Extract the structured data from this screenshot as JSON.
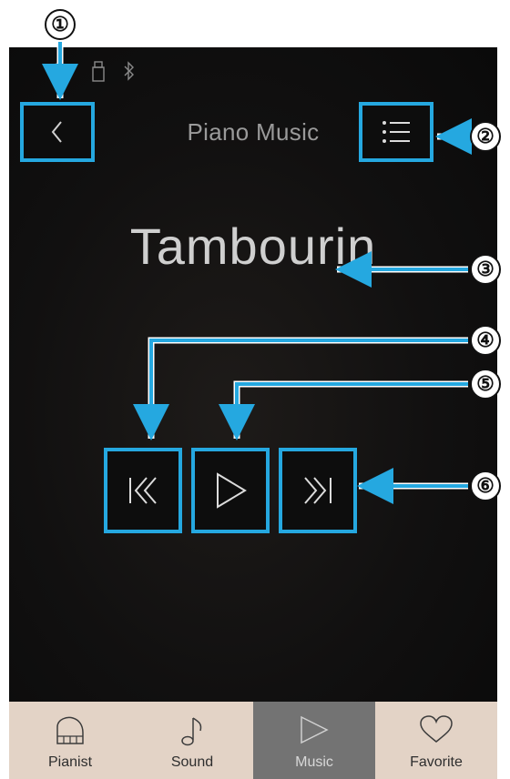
{
  "header": {
    "title": "Piano Music"
  },
  "now_playing": {
    "song_title": "Tambourin"
  },
  "bottom_nav": {
    "items": [
      {
        "label": "Pianist",
        "icon": "piano-icon",
        "active": false
      },
      {
        "label": "Sound",
        "icon": "music-note-icon",
        "active": false
      },
      {
        "label": "Music",
        "icon": "play-icon",
        "active": true
      },
      {
        "label": "Favorite",
        "icon": "heart-icon",
        "active": false
      }
    ]
  },
  "callouts": [
    "①",
    "②",
    "③",
    "④",
    "⑤",
    "⑥"
  ],
  "colors": {
    "highlight": "#25a8e0",
    "nav_bg": "#e3d3c6",
    "nav_active_bg": "#737373",
    "screen_bg": "#111010"
  }
}
